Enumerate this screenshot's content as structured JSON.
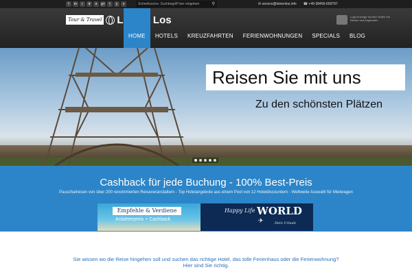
{
  "topbar": {
    "social_icons": [
      "facebook-icon",
      "linkedin-icon",
      "rss-icon",
      "dribbble-icon",
      "skype-icon",
      "google-plus-icon",
      "twitter-icon",
      "youtube-icon",
      "vimeo-icon"
    ],
    "social_glyphs": [
      "f",
      "in",
      "r",
      "d",
      "s",
      "g+",
      "t",
      "y",
      "v"
    ],
    "search_placeholder": "Schnellsuche: Suchbegriff hier eingeben",
    "email": "service@leinenlos.info",
    "phone": "+49-38456-669797"
  },
  "header": {
    "logo_tag": "Tour & Travel",
    "logo_name": "Leinen Los",
    "ad_text": "Logo Anzeige auf den Seiten mit Reisen und Angeboten"
  },
  "nav": {
    "items": [
      "HOME",
      "HOTELS",
      "KREUZFAHRTEN",
      "FERIENWOHNUNGEN",
      "SPECIALS",
      "BLOG"
    ],
    "active": "HOME"
  },
  "hero": {
    "headline": "Reisen Sie mit uns",
    "subline": "Zu den schönsten Plätzen",
    "slides": 5,
    "active_slide": 1
  },
  "band": {
    "title": "Cashback für jede Buchung - 100% Best-Preis",
    "text": "Pauschalreisen von über 200 renommierten Reiseveranstaltern - Top Hotelangebote aus einem Pool von 12 Hoteldiscountern - Weltweite Auswahl für Mietwagen",
    "banner": {
      "line1": "Empfehle & Verdiene",
      "line2": "Anbieterpreis + Cashback",
      "happy": "Happy Life",
      "world": "WORLD",
      "urlaub": "Dein Urlaub"
    }
  },
  "intro": {
    "text": "Sie wissen wo die Reise hingehen soll und suchen das richtige Hotel, das tolle Ferienhaus oder die Ferienwohnung?",
    "text2": "Hier sind Sie richtig."
  },
  "colors": {
    "accent": "#2c85c8",
    "topbar": "#1e1e1e",
    "header": "#2a2a2a"
  }
}
